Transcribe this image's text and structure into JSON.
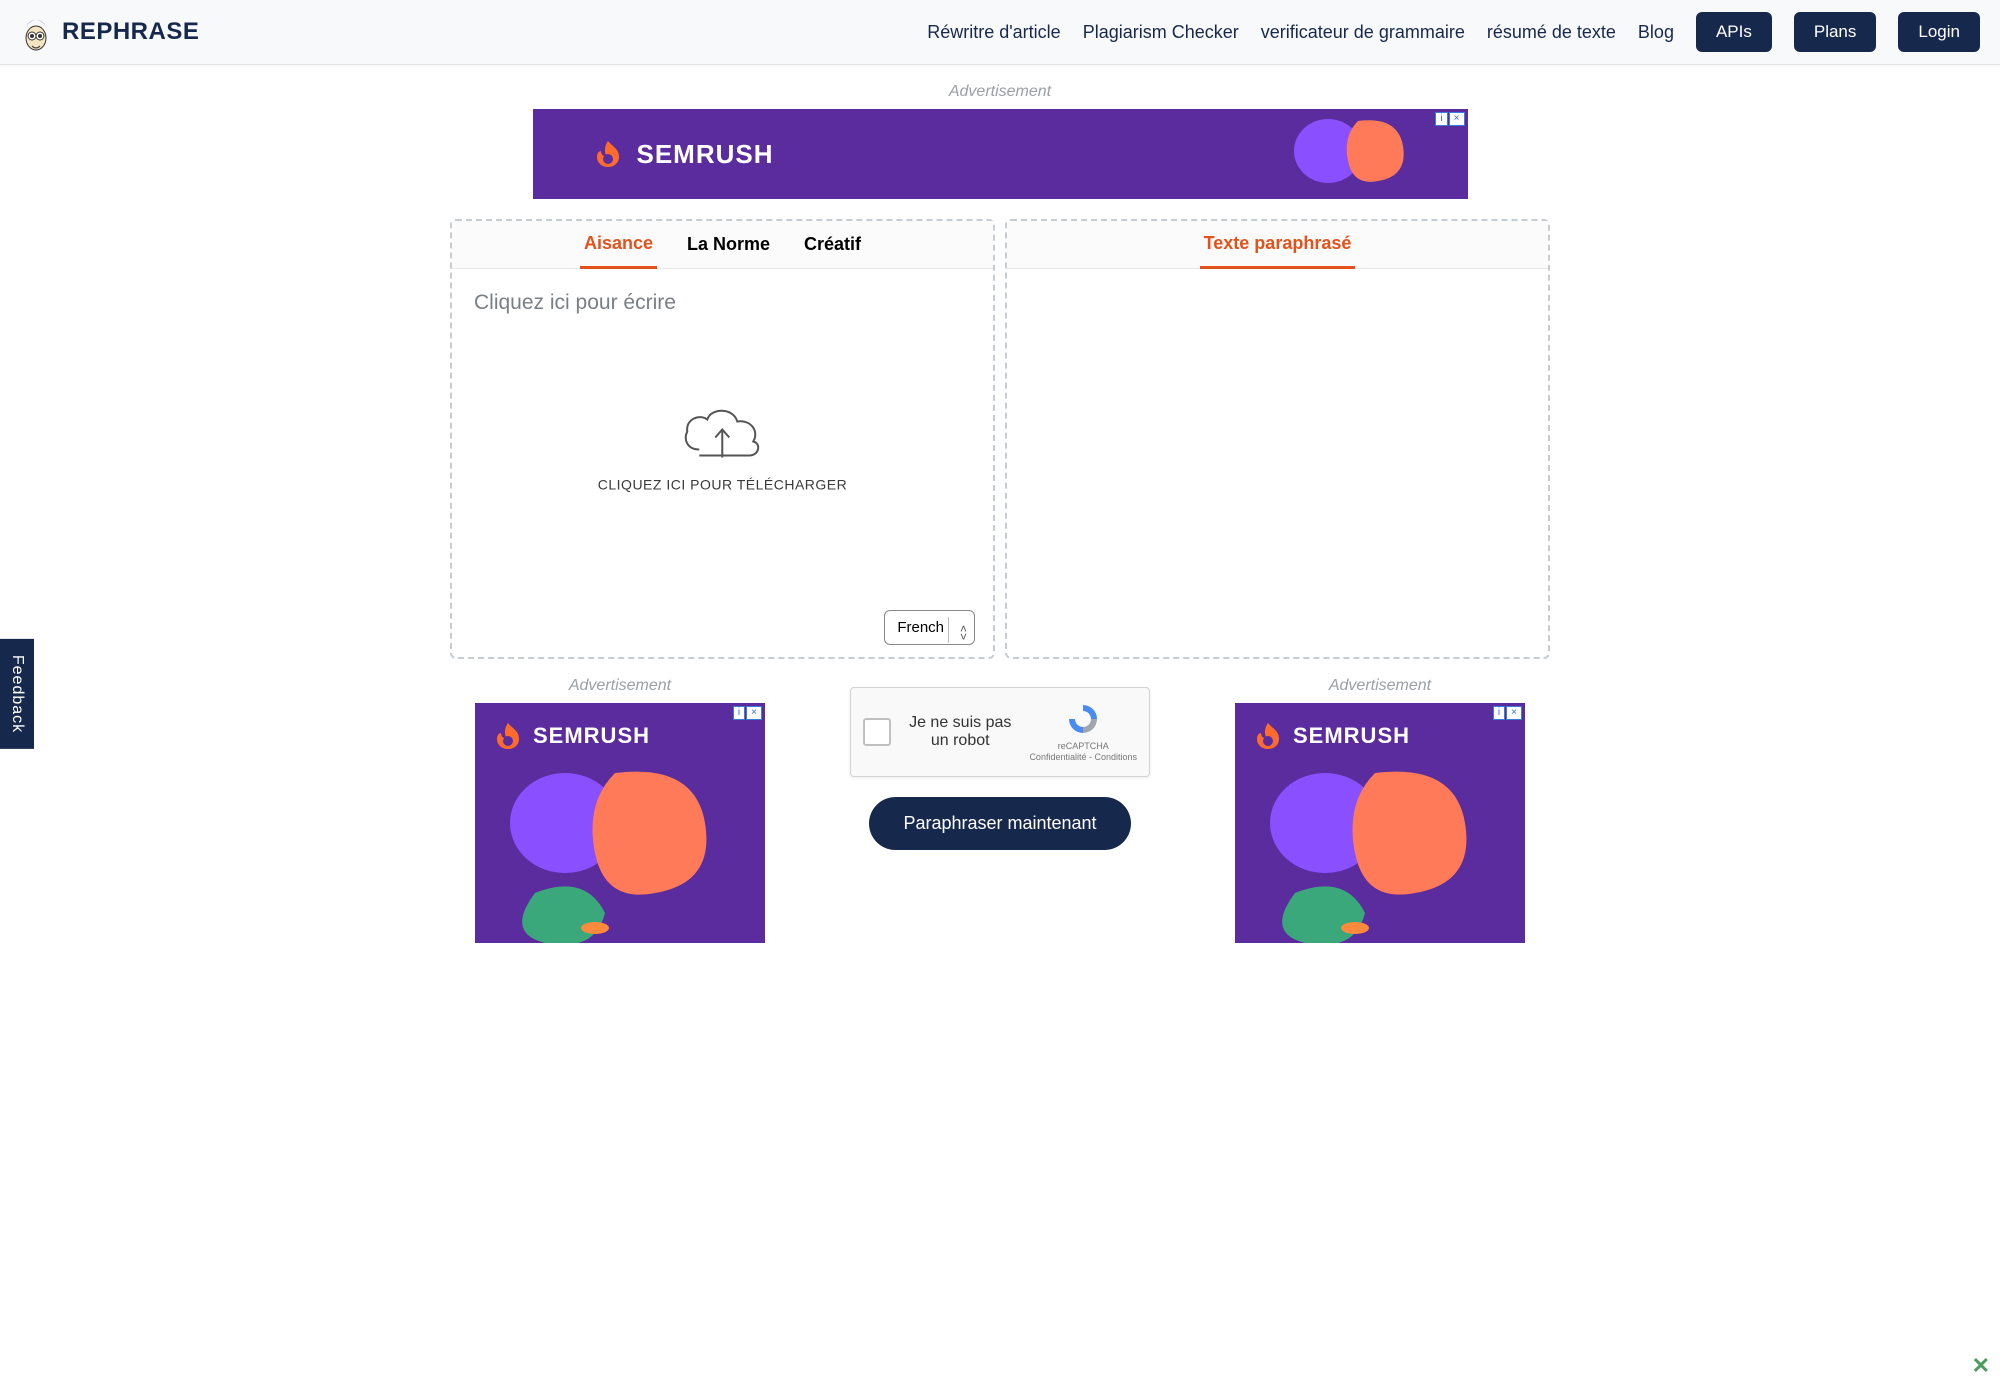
{
  "header": {
    "brand": "REPHRASE",
    "nav": {
      "rewriter": "Réwritre d'article",
      "plagiarism": "Plagiarism Checker",
      "grammar": "verificateur de grammaire",
      "summarize": "résumé de texte",
      "blog": "Blog",
      "apis": "APIs",
      "plans": "Plans",
      "login": "Login"
    }
  },
  "ads": {
    "label_top": "Advertisement",
    "label_left": "Advertisement",
    "label_right": "Advertisement",
    "brand": "SEMRUSH",
    "info_symbol": "i",
    "close_symbol": "×"
  },
  "input_panel": {
    "tabs": {
      "fluency": "Aisance",
      "standard": "La Norme",
      "creative": "Créatif"
    },
    "placeholder": "Cliquez ici pour écrire",
    "upload_label": "CLIQUEZ ICI POUR TÉLÉCHARGER",
    "language_selected": "French"
  },
  "output_panel": {
    "tab": "Texte paraphrasé"
  },
  "captcha": {
    "text": "Je ne suis pas un robot",
    "brand": "reCAPTCHA",
    "links": "Confidentialité - Conditions"
  },
  "action_button": "Paraphraser maintenant",
  "feedback": "Feedback"
}
